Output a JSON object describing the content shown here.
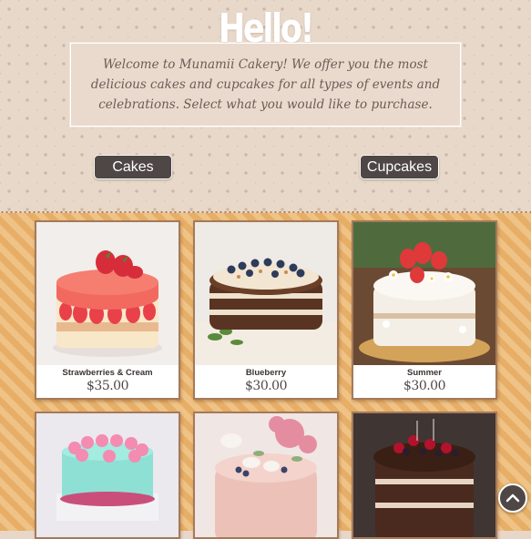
{
  "hero": {
    "title": "Hello!",
    "welcome": "Welcome to Munamii Cakery! We offer you the most delicious cakes and cupcakes for all types of events and celebrations. Select what you would like to purchase."
  },
  "buttons": {
    "cakes": "Cakes",
    "cupcakes": "Cupcakes"
  },
  "products": [
    {
      "name": "Strawberries & Cream",
      "price": "$35.00"
    },
    {
      "name": "Blueberry",
      "price": "$30.00"
    },
    {
      "name": "Summer",
      "price": "$30.00"
    },
    {
      "name": "",
      "price": ""
    },
    {
      "name": "",
      "price": ""
    },
    {
      "name": "",
      "price": ""
    }
  ],
  "icons": {
    "scroll_top": "chevron-up-icon"
  },
  "colors": {
    "button_bg": "#4e4746",
    "hero_bg": "#e8d8c9",
    "products_bg": "#e9b46f",
    "card_border": "#a47a5a"
  }
}
